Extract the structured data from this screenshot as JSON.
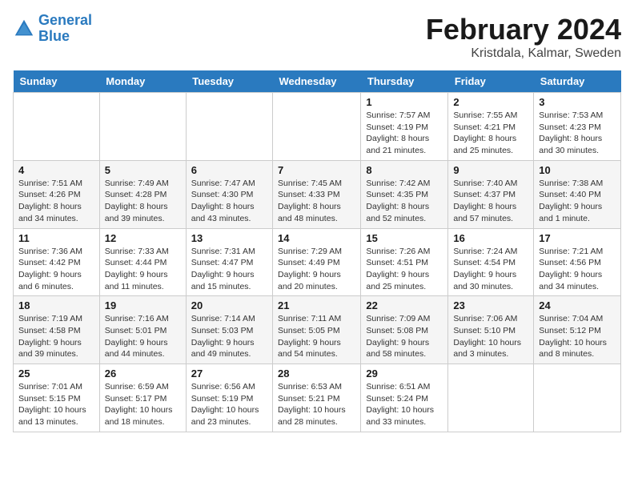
{
  "header": {
    "logo_line1": "General",
    "logo_line2": "Blue",
    "month": "February 2024",
    "location": "Kristdala, Kalmar, Sweden"
  },
  "weekdays": [
    "Sunday",
    "Monday",
    "Tuesday",
    "Wednesday",
    "Thursday",
    "Friday",
    "Saturday"
  ],
  "weeks": [
    [
      {
        "day": "",
        "info": ""
      },
      {
        "day": "",
        "info": ""
      },
      {
        "day": "",
        "info": ""
      },
      {
        "day": "",
        "info": ""
      },
      {
        "day": "1",
        "info": "Sunrise: 7:57 AM\nSunset: 4:19 PM\nDaylight: 8 hours and 21 minutes."
      },
      {
        "day": "2",
        "info": "Sunrise: 7:55 AM\nSunset: 4:21 PM\nDaylight: 8 hours and 25 minutes."
      },
      {
        "day": "3",
        "info": "Sunrise: 7:53 AM\nSunset: 4:23 PM\nDaylight: 8 hours and 30 minutes."
      }
    ],
    [
      {
        "day": "4",
        "info": "Sunrise: 7:51 AM\nSunset: 4:26 PM\nDaylight: 8 hours and 34 minutes."
      },
      {
        "day": "5",
        "info": "Sunrise: 7:49 AM\nSunset: 4:28 PM\nDaylight: 8 hours and 39 minutes."
      },
      {
        "day": "6",
        "info": "Sunrise: 7:47 AM\nSunset: 4:30 PM\nDaylight: 8 hours and 43 minutes."
      },
      {
        "day": "7",
        "info": "Sunrise: 7:45 AM\nSunset: 4:33 PM\nDaylight: 8 hours and 48 minutes."
      },
      {
        "day": "8",
        "info": "Sunrise: 7:42 AM\nSunset: 4:35 PM\nDaylight: 8 hours and 52 minutes."
      },
      {
        "day": "9",
        "info": "Sunrise: 7:40 AM\nSunset: 4:37 PM\nDaylight: 8 hours and 57 minutes."
      },
      {
        "day": "10",
        "info": "Sunrise: 7:38 AM\nSunset: 4:40 PM\nDaylight: 9 hours and 1 minute."
      }
    ],
    [
      {
        "day": "11",
        "info": "Sunrise: 7:36 AM\nSunset: 4:42 PM\nDaylight: 9 hours and 6 minutes."
      },
      {
        "day": "12",
        "info": "Sunrise: 7:33 AM\nSunset: 4:44 PM\nDaylight: 9 hours and 11 minutes."
      },
      {
        "day": "13",
        "info": "Sunrise: 7:31 AM\nSunset: 4:47 PM\nDaylight: 9 hours and 15 minutes."
      },
      {
        "day": "14",
        "info": "Sunrise: 7:29 AM\nSunset: 4:49 PM\nDaylight: 9 hours and 20 minutes."
      },
      {
        "day": "15",
        "info": "Sunrise: 7:26 AM\nSunset: 4:51 PM\nDaylight: 9 hours and 25 minutes."
      },
      {
        "day": "16",
        "info": "Sunrise: 7:24 AM\nSunset: 4:54 PM\nDaylight: 9 hours and 30 minutes."
      },
      {
        "day": "17",
        "info": "Sunrise: 7:21 AM\nSunset: 4:56 PM\nDaylight: 9 hours and 34 minutes."
      }
    ],
    [
      {
        "day": "18",
        "info": "Sunrise: 7:19 AM\nSunset: 4:58 PM\nDaylight: 9 hours and 39 minutes."
      },
      {
        "day": "19",
        "info": "Sunrise: 7:16 AM\nSunset: 5:01 PM\nDaylight: 9 hours and 44 minutes."
      },
      {
        "day": "20",
        "info": "Sunrise: 7:14 AM\nSunset: 5:03 PM\nDaylight: 9 hours and 49 minutes."
      },
      {
        "day": "21",
        "info": "Sunrise: 7:11 AM\nSunset: 5:05 PM\nDaylight: 9 hours and 54 minutes."
      },
      {
        "day": "22",
        "info": "Sunrise: 7:09 AM\nSunset: 5:08 PM\nDaylight: 9 hours and 58 minutes."
      },
      {
        "day": "23",
        "info": "Sunrise: 7:06 AM\nSunset: 5:10 PM\nDaylight: 10 hours and 3 minutes."
      },
      {
        "day": "24",
        "info": "Sunrise: 7:04 AM\nSunset: 5:12 PM\nDaylight: 10 hours and 8 minutes."
      }
    ],
    [
      {
        "day": "25",
        "info": "Sunrise: 7:01 AM\nSunset: 5:15 PM\nDaylight: 10 hours and 13 minutes."
      },
      {
        "day": "26",
        "info": "Sunrise: 6:59 AM\nSunset: 5:17 PM\nDaylight: 10 hours and 18 minutes."
      },
      {
        "day": "27",
        "info": "Sunrise: 6:56 AM\nSunset: 5:19 PM\nDaylight: 10 hours and 23 minutes."
      },
      {
        "day": "28",
        "info": "Sunrise: 6:53 AM\nSunset: 5:21 PM\nDaylight: 10 hours and 28 minutes."
      },
      {
        "day": "29",
        "info": "Sunrise: 6:51 AM\nSunset: 5:24 PM\nDaylight: 10 hours and 33 minutes."
      },
      {
        "day": "",
        "info": ""
      },
      {
        "day": "",
        "info": ""
      }
    ]
  ]
}
